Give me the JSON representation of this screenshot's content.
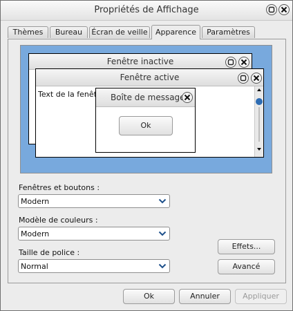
{
  "window": {
    "title": "Propriétés de Affichage"
  },
  "tabs": [
    {
      "label": "Thèmes"
    },
    {
      "label": "Bureau"
    },
    {
      "label": "Écran de veille"
    },
    {
      "label": "Apparence"
    },
    {
      "label": "Paramètres"
    }
  ],
  "active_tab": "Apparence",
  "preview": {
    "inactive_title": "Fenêtre inactive",
    "active_title": "Fenêtre active",
    "window_text": "Text de la fenêtre",
    "message_title": "Boîte de message",
    "ok_label": "Ok"
  },
  "form": {
    "windows_buttons_label": "Fenêtres et boutons :",
    "windows_buttons_value": "Modern",
    "color_scheme_label": "Modèle de couleurs :",
    "color_scheme_value": "Modern",
    "font_size_label": "Taille de police :",
    "font_size_value": "Normal",
    "effects_label": "Effets...",
    "advanced_label": "Avancé"
  },
  "footer": {
    "ok_label": "Ok",
    "cancel_label": "Annuler",
    "apply_label": "Appliquer"
  },
  "colors": {
    "preview_background": "#78a9dd",
    "scroll_thumb": "#2d6cb3"
  }
}
